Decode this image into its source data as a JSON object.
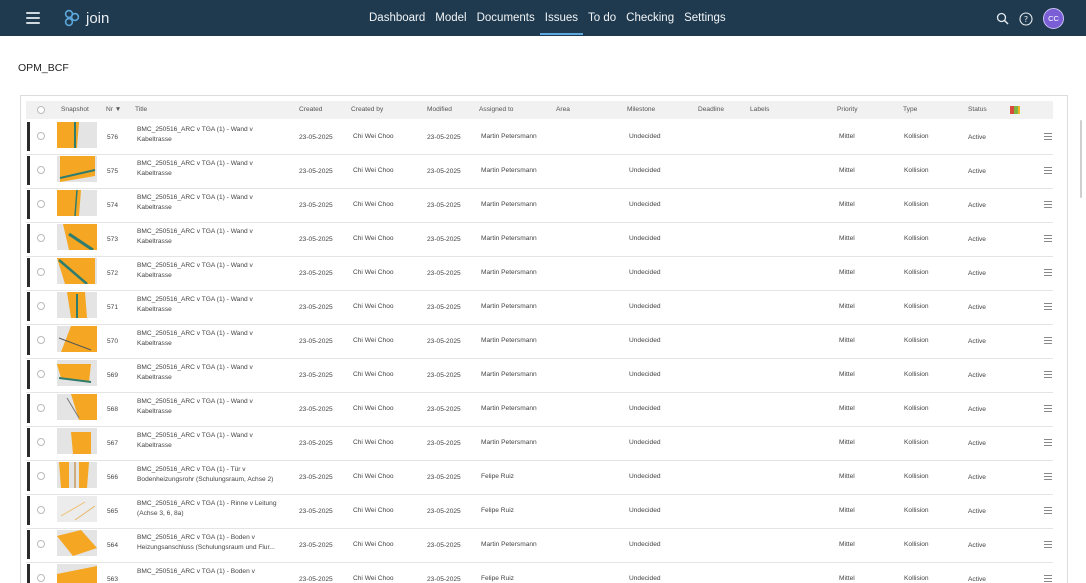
{
  "app": {
    "name": "join"
  },
  "nav": {
    "items": [
      {
        "id": "dashboard",
        "label": "Dashboard"
      },
      {
        "id": "model",
        "label": "Model"
      },
      {
        "id": "documents",
        "label": "Documents"
      },
      {
        "id": "issues",
        "label": "Issues",
        "active": true
      },
      {
        "id": "todo",
        "label": "To do"
      },
      {
        "id": "checking",
        "label": "Checking"
      },
      {
        "id": "settings",
        "label": "Settings"
      }
    ]
  },
  "user": {
    "initials": "CC",
    "avatar_color": "#7a5ed6"
  },
  "page": {
    "title": "OPM_BCF"
  },
  "table": {
    "columns": {
      "snapshot": "Snapshot",
      "nr": "Nr ▼",
      "title": "Title",
      "created": "Created",
      "created_by": "Created by",
      "modified": "Modified",
      "assigned_to": "Assigned to",
      "area": "Area",
      "milestone": "Milestone",
      "deadline": "Deadline",
      "labels": "Labels",
      "priority": "Priority",
      "type": "Type",
      "status": "Status"
    },
    "rows": [
      {
        "nr": "576",
        "title": "BMC_250516_ARC v TGA (1) - Wand v Kabeltrasse",
        "created": "23-05-2025",
        "created_by": "Chi Wei Choo",
        "modified": "23-05-2025",
        "assigned_to": "Martin Petersmann",
        "milestone": "Undecided",
        "priority": "Mittel",
        "type": "Kollision",
        "status": "Active",
        "snap": "a"
      },
      {
        "nr": "575",
        "title": "BMC_250516_ARC v TGA (1) - Wand v Kabeltrasse",
        "created": "23-05-2025",
        "created_by": "Chi Wei Choo",
        "modified": "23-05-2025",
        "assigned_to": "Martin Petersmann",
        "milestone": "Undecided",
        "priority": "Mittel",
        "type": "Kollision",
        "status": "Active",
        "snap": "b"
      },
      {
        "nr": "574",
        "title": "BMC_250516_ARC v TGA (1) - Wand v Kabeltrasse",
        "created": "23-05-2025",
        "created_by": "Chi Wei Choo",
        "modified": "23-05-2025",
        "assigned_to": "Martin Petersmann",
        "milestone": "Undecided",
        "priority": "Mittel",
        "type": "Kollision",
        "status": "Active",
        "snap": "c"
      },
      {
        "nr": "573",
        "title": "BMC_250516_ARC v TGA (1) - Wand v Kabeltrasse",
        "created": "23-05-2025",
        "created_by": "Chi Wei Choo",
        "modified": "23-05-2025",
        "assigned_to": "Martin Petersmann",
        "milestone": "Undecided",
        "priority": "Mittel",
        "type": "Kollision",
        "status": "Active",
        "snap": "d"
      },
      {
        "nr": "572",
        "title": "BMC_250516_ARC v TGA (1) - Wand v Kabeltrasse",
        "created": "23-05-2025",
        "created_by": "Chi Wei Choo",
        "modified": "23-05-2025",
        "assigned_to": "Martin Petersmann",
        "milestone": "Undecided",
        "priority": "Mittel",
        "type": "Kollision",
        "status": "Active",
        "snap": "e"
      },
      {
        "nr": "571",
        "title": "BMC_250516_ARC v TGA (1) - Wand v Kabeltrasse",
        "created": "23-05-2025",
        "created_by": "Chi Wei Choo",
        "modified": "23-05-2025",
        "assigned_to": "Martin Petersmann",
        "milestone": "Undecided",
        "priority": "Mittel",
        "type": "Kollision",
        "status": "Active",
        "snap": "f"
      },
      {
        "nr": "570",
        "title": "BMC_250516_ARC v TGA (1) - Wand v Kabeltrasse",
        "created": "23-05-2025",
        "created_by": "Chi Wei Choo",
        "modified": "23-05-2025",
        "assigned_to": "Martin Petersmann",
        "milestone": "Undecided",
        "priority": "Mittel",
        "type": "Kollision",
        "status": "Active",
        "snap": "g"
      },
      {
        "nr": "569",
        "title": "BMC_250516_ARC v TGA (1) - Wand v Kabeltrasse",
        "created": "23-05-2025",
        "created_by": "Chi Wei Choo",
        "modified": "23-05-2025",
        "assigned_to": "Martin Petersmann",
        "milestone": "Undecided",
        "priority": "Mittel",
        "type": "Kollision",
        "status": "Active",
        "snap": "h"
      },
      {
        "nr": "568",
        "title": "BMC_250516_ARC v TGA (1) - Wand v Kabeltrasse",
        "created": "23-05-2025",
        "created_by": "Chi Wei Choo",
        "modified": "23-05-2025",
        "assigned_to": "Martin Petersmann",
        "milestone": "Undecided",
        "priority": "Mittel",
        "type": "Kollision",
        "status": "Active",
        "snap": "i"
      },
      {
        "nr": "567",
        "title": "BMC_250516_ARC v TGA (1) - Wand v Kabeltrasse",
        "created": "23-05-2025",
        "created_by": "Chi Wei Choo",
        "modified": "23-05-2025",
        "assigned_to": "Martin Petersmann",
        "milestone": "Undecided",
        "priority": "Mittel",
        "type": "Kollision",
        "status": "Active",
        "snap": "j"
      },
      {
        "nr": "566",
        "title": "BMC_250516_ARC v TGA (1) - Tür v Bodenheizungsrohr (Schulungsraum, Achse 2)",
        "created": "23-05-2025",
        "created_by": "Chi Wei Choo",
        "modified": "23-05-2025",
        "assigned_to": "Felipe Ruiz",
        "milestone": "Undecided",
        "priority": "Mittel",
        "type": "Kollision",
        "status": "Active",
        "snap": "k"
      },
      {
        "nr": "565",
        "title": "BMC_250516_ARC v TGA (1) - Rinne v Leitung (Achse 3, 6, 8a)",
        "created": "23-05-2025",
        "created_by": "Chi Wei Choo",
        "modified": "23-05-2025",
        "assigned_to": "Felipe Ruiz",
        "milestone": "Undecided",
        "priority": "Mittel",
        "type": "Kollision",
        "status": "Active",
        "snap": "l"
      },
      {
        "nr": "564",
        "title": "BMC_250516_ARC v TGA (1) - Boden v Heizungsanschluss (Schulungsraum und Flur...",
        "created": "23-05-2025",
        "created_by": "Chi Wei Choo",
        "modified": "23-05-2025",
        "assigned_to": "Martin Petersmann",
        "milestone": "Undecided",
        "priority": "Mittel",
        "type": "Kollision",
        "status": "Active",
        "snap": "m"
      },
      {
        "nr": "563",
        "title": "BMC_250516_ARC v TGA (1) - Boden v",
        "created": "23-05-2025",
        "created_by": "Chi Wei Choo",
        "modified": "23-05-2025",
        "assigned_to": "Felipe Ruiz",
        "milestone": "Undecided",
        "priority": "Mittel",
        "type": "Kollision",
        "status": "Active",
        "snap": "n"
      }
    ]
  },
  "colors": {
    "topbar": "#1f3a4f",
    "accent": "#5ca7dc",
    "snapshot_orange": "#f5a623"
  },
  "icons": {
    "menu": "hamburger-icon",
    "search": "search-icon",
    "help": "help-icon",
    "flag": "flag-icon",
    "row_menu": "row-menu-icon"
  }
}
